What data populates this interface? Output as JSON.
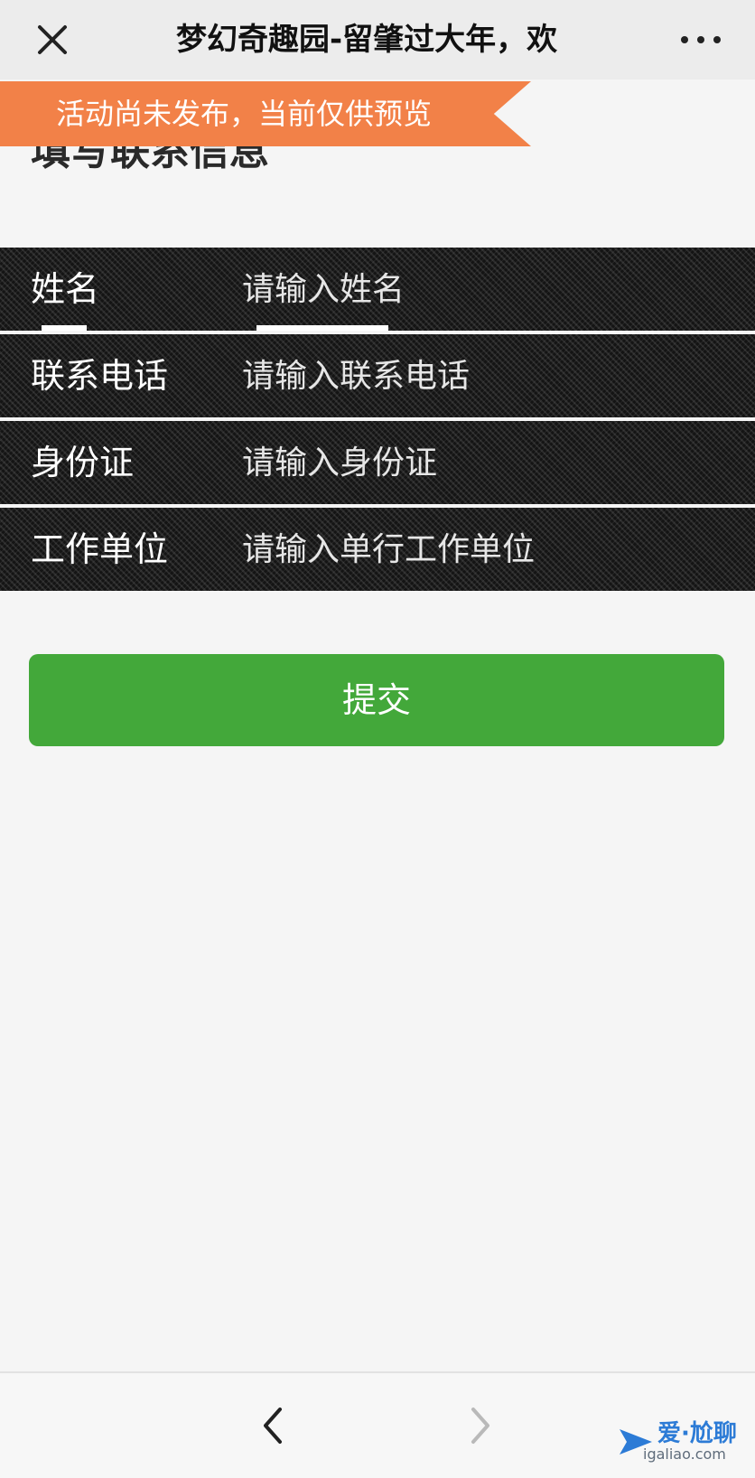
{
  "header": {
    "title": "梦幻奇趣园-留肇过大年，欢",
    "close_icon": "close-icon",
    "more_icon": "more-dots-icon"
  },
  "banner": {
    "text": "活动尚未发布，当前仅供预览",
    "color": "#f28148"
  },
  "section": {
    "title": "填写联系信息"
  },
  "form": {
    "fields": [
      {
        "label": "姓名",
        "placeholder": "请输入姓名",
        "value": ""
      },
      {
        "label": "联系电话",
        "placeholder": "请输入联系电话",
        "value": ""
      },
      {
        "label": "身份证",
        "placeholder": "请输入身份证",
        "value": ""
      },
      {
        "label": "工作单位",
        "placeholder": "请输入单行工作单位",
        "value": ""
      }
    ]
  },
  "submit": {
    "label": "提交",
    "color": "#43a83a"
  },
  "nav": {
    "back_icon": "chevron-left-icon",
    "forward_icon": "chevron-right-icon"
  },
  "watermark": {
    "text": "爱·尬聊",
    "url": "igaliao.com"
  }
}
